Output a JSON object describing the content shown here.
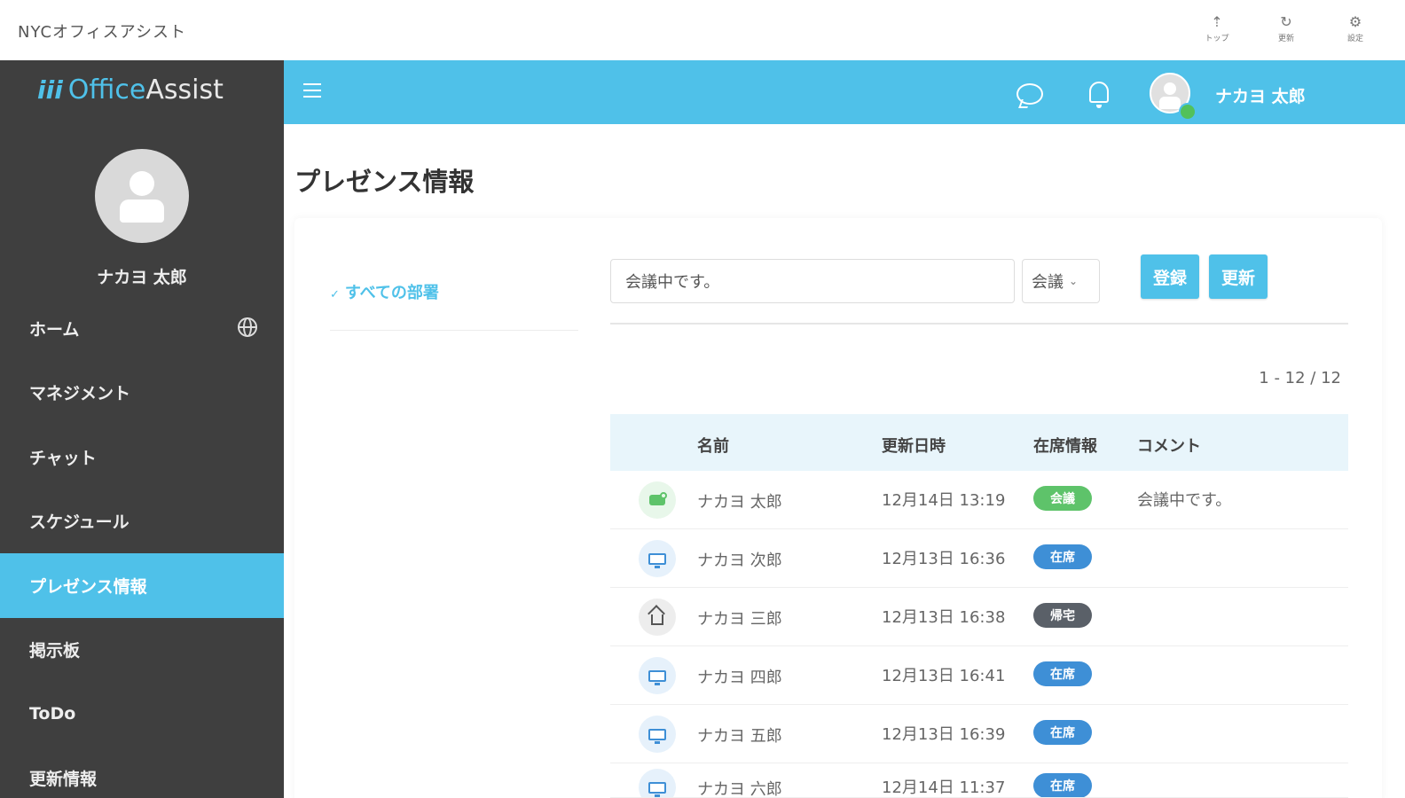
{
  "window": {
    "title": "NYCオフィスアシスト"
  },
  "toolbar": [
    {
      "icon": "top-icon",
      "glyph": "⇡",
      "label": "トップ"
    },
    {
      "icon": "refresh-icon",
      "glyph": "↻",
      "label": "更新"
    },
    {
      "icon": "settings-icon",
      "glyph": "⚙",
      "label": "設定"
    }
  ],
  "logo": {
    "mark": "iii",
    "word1": "Office",
    "word2": "Assist"
  },
  "sidebar": {
    "profile_name": "ナカヨ 太郎",
    "items": [
      {
        "label": "ホーム",
        "icon": "globe-icon",
        "active": false
      },
      {
        "label": "マネジメント",
        "active": false
      },
      {
        "label": "チャット",
        "active": false
      },
      {
        "label": "スケジュール",
        "active": false
      },
      {
        "label": "プレゼンス情報",
        "active": true
      },
      {
        "label": "掲示板",
        "active": false
      },
      {
        "label": "ToDo",
        "active": false
      },
      {
        "label": "更新情報",
        "active": false
      }
    ]
  },
  "header": {
    "user_name": "ナカヨ 太郎",
    "online_color": "#52c15b"
  },
  "page": {
    "title": "プレゼンス情報"
  },
  "filters": {
    "department": "すべての部署"
  },
  "form": {
    "comment_value": "会議中です。",
    "status_selected": "会議",
    "register_label": "登録",
    "update_label": "更新"
  },
  "pagination": "1 - 12 / 12",
  "table": {
    "columns": [
      "名前",
      "更新日時",
      "在席情報",
      "コメント"
    ],
    "rows": [
      {
        "icon": "talk-icon",
        "name": "ナカヨ 太郎",
        "updated": "12月14日 13:19",
        "status": "会議",
        "status_color": "#5ec36a",
        "comment": "会議中です。"
      },
      {
        "icon": "desk-icon",
        "name": "ナカヨ 次郎",
        "updated": "12月13日 16:36",
        "status": "在席",
        "status_color": "#3e8fd6",
        "comment": ""
      },
      {
        "icon": "home-icon",
        "name": "ナカヨ 三郎",
        "updated": "12月13日 16:38",
        "status": "帰宅",
        "status_color": "#5a6068",
        "comment": ""
      },
      {
        "icon": "desk-icon",
        "name": "ナカヨ 四郎",
        "updated": "12月13日 16:41",
        "status": "在席",
        "status_color": "#3e8fd6",
        "comment": ""
      },
      {
        "icon": "desk-icon",
        "name": "ナカヨ 五郎",
        "updated": "12月13日 16:39",
        "status": "在席",
        "status_color": "#3e8fd6",
        "comment": ""
      },
      {
        "icon": "desk-icon",
        "name": "ナカヨ 六郎",
        "updated": "12月14日 11:37",
        "status": "在席",
        "status_color": "#3e8fd6",
        "comment": ""
      }
    ]
  },
  "colors": {
    "accent": "#4fc1e9",
    "sidebar": "#3f3f3f",
    "table_header": "#e8f5fb"
  }
}
